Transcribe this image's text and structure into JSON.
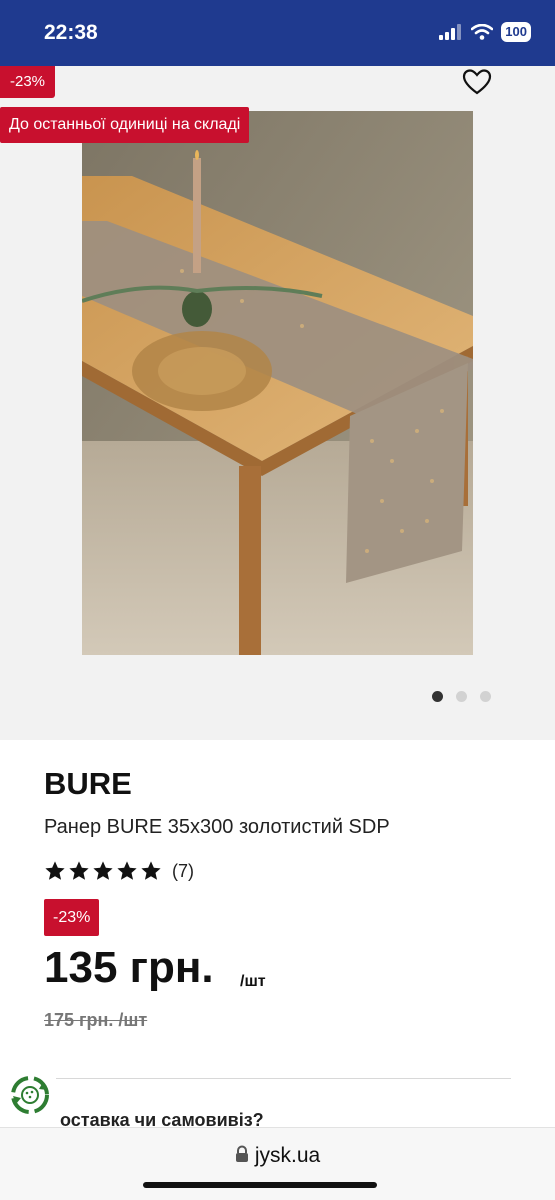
{
  "status_bar": {
    "time": "22:38",
    "battery": "100"
  },
  "gallery": {
    "discount_badge": "-23%",
    "stock_badge": "До останньої одиниці на складі",
    "dots_total": 3,
    "active_dot": 1
  },
  "product": {
    "brand": "BURE",
    "name": "Ранер BURE 35x300 золотистий SDP",
    "rating_stars": 5,
    "rating_count": "(7)",
    "discount_badge": "-23%",
    "price": "135 грн.",
    "price_unit": "/шт",
    "old_price": "175 грн. /шт"
  },
  "delivery": {
    "question": "оставка чи самовивіз?"
  },
  "browser": {
    "url": "jysk.ua"
  },
  "colors": {
    "brand_blue": "#1f3a8f",
    "badge_red": "#c8102e"
  }
}
